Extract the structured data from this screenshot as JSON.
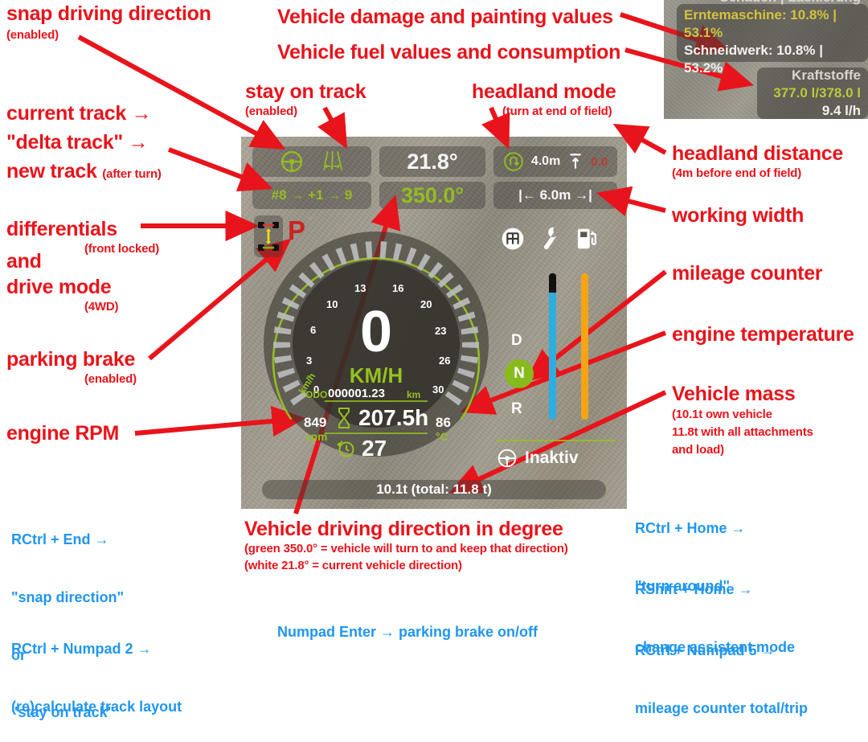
{
  "hud": {
    "top_left_icons": [
      "steering-wheel-icon",
      "track-lines-icon"
    ],
    "heading_current": "21.8°",
    "headland": {
      "icon": "u-turn-icon",
      "distance": "4.0m",
      "arrow_icon": "headland-arrow-icon",
      "value": "0.0"
    },
    "track_info": "#8 → +1 → 9",
    "heading_target": "350.0°",
    "working_width": "|← 6.0m →|",
    "differential_icon": "differential-lock-icon",
    "parking_brake": "P",
    "right_icons": [
      "gearbox-icon",
      "wrench-icon",
      "fuel-pump-icon"
    ],
    "gauge": {
      "speed": "0",
      "speed_unit": "KM/H",
      "axis_unit": "km/h",
      "ticks": [
        "0",
        "3",
        "6",
        "10",
        "13",
        "16",
        "20",
        "23",
        "26",
        "30"
      ],
      "odo_label": "ODO",
      "odo_value": "000001.23",
      "odo_unit": "km",
      "hours_icon": "hourglass-icon",
      "hours_value": "207.5h",
      "maint_icon": "service-timer-icon",
      "maint_value": "27",
      "rpm_value": "849",
      "rpm_label": "rpm",
      "temp_value": "86",
      "temp_label": "°C"
    },
    "gears": {
      "drive": "D",
      "neutral": "N",
      "reverse": "R"
    },
    "assistant": {
      "icon": "steering-assist-icon",
      "label": "Inaktiv"
    },
    "mass": "10.1t (total: 11.8 t)"
  },
  "inset": {
    "damage_title": "Schaden | Lackierung",
    "damage_rows": [
      {
        "label": "Erntemaschine:",
        "value": "10.8% | 53.1%",
        "color": "#d3c33d"
      },
      {
        "label": "Schneidwerk:",
        "value": "10.8% | 53.2%",
        "color": "#f2f2ee"
      }
    ],
    "fuel_title": "Kraftstoffe",
    "fuel_level": "377.0 l/378.0 l",
    "fuel_rate": "9.4 l/h"
  },
  "annotations": {
    "snap_direction": {
      "title": "snap driving direction",
      "sub": "(enabled)"
    },
    "tracks": {
      "l1": "current track →",
      "l2": "\"delta track\" →",
      "l3": "new track ",
      "l3sub": "(after turn)"
    },
    "differentials": {
      "l1": "differentials",
      "sub1": "(front locked)",
      "l2": "and",
      "l3": "drive mode",
      "sub2": "(4WD)"
    },
    "parking_brake": {
      "title": "parking brake",
      "sub": "(enabled)"
    },
    "engine_rpm": {
      "title": "engine RPM"
    },
    "damage": {
      "title": "Vehicle damage and painting values"
    },
    "fuel": {
      "title": "Vehicle fuel values and consumption"
    },
    "stay_on_track": {
      "title": "stay on track",
      "sub": "(enabled)"
    },
    "headland_mode": {
      "title": "headland mode",
      "sub": "(turn at end of field)"
    },
    "headland_distance": {
      "title": "headland distance",
      "sub": "(4m before end of field)"
    },
    "working_width": {
      "title": "working width"
    },
    "mileage_counter": {
      "title": "mileage counter"
    },
    "engine_temperature": {
      "title": "engine temperature"
    },
    "vehicle_mass": {
      "title": "Vehicle mass",
      "sub1": "(10.1t own vehicle",
      "sub2": "11.8t with all attachments",
      "sub3": "and load)"
    },
    "driving_direction": {
      "title": "Vehicle driving direction in degree",
      "sub1": "(green 350.0° = vehicle will turn to and keep that direction)",
      "sub2": "(white 21.8° = current vehicle direction)"
    }
  },
  "shortcuts": {
    "left": [
      "RCtrl + End →",
      "\"snap direction\"",
      "or",
      "\"stay on track\""
    ],
    "left2": [
      "RCtrl + Numpad 2 →",
      "(re)calculate track layout"
    ],
    "center": "Numpad Enter → parking brake on/off",
    "right1": [
      "RCtrl + Home →",
      "\"turn around\""
    ],
    "right2": [
      "RShift + Home →",
      "change assistent mode"
    ],
    "right3": [
      "RCtrl + Numpad 5 →",
      "mileage counter total/trip"
    ]
  },
  "colors": {
    "annotation": "#e8141b",
    "shortcut": "#2196ee",
    "accent_green": "#96c11e",
    "fuel_orange": "#f5a417",
    "def_blue": "#2eaede"
  }
}
